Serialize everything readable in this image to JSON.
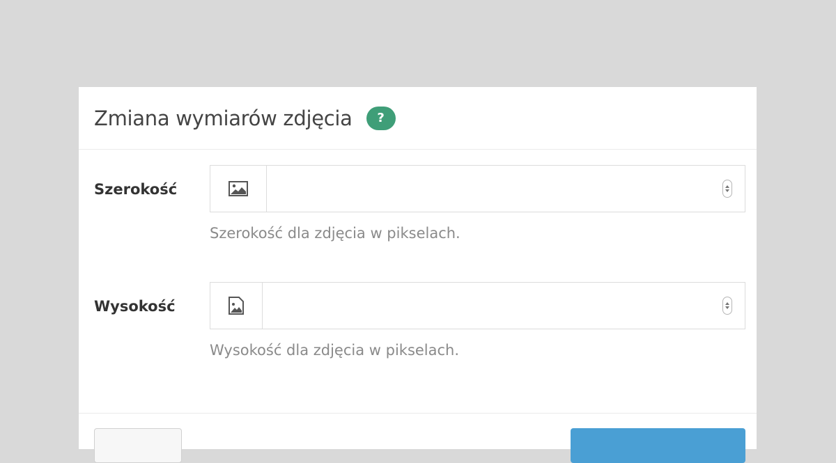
{
  "dialog": {
    "title": "Zmiana wymiarów zdjęcia",
    "help_icon_text": "?"
  },
  "fields": {
    "width": {
      "label": "Szerokość",
      "value": "",
      "icon": "image-landscape-icon",
      "help": "Szerokość dla zdjęcia w pikselach."
    },
    "height": {
      "label": "Wysokość",
      "value": "",
      "icon": "image-portrait-icon",
      "help": "Wysokość dla zdjęcia w pikselach."
    }
  },
  "colors": {
    "help_badge": "#3f9e78",
    "primary_button": "#4a9fd4",
    "background": "#d9d9d9"
  }
}
